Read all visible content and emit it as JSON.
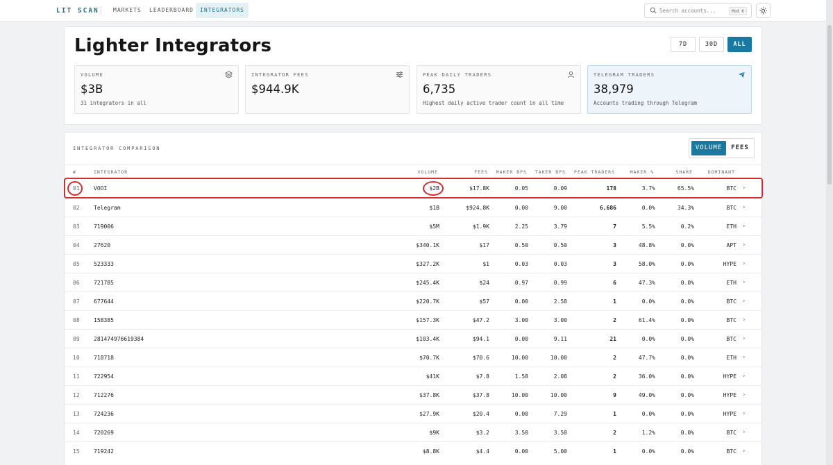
{
  "topbar": {
    "brand": "LIT SCAN",
    "nav": [
      "MARKETS",
      "LEADERBOARD",
      "INTEGRATORS"
    ],
    "active_nav": "INTEGRATORS",
    "search_placeholder": "Search accounts...",
    "search_shortcut": "Mod K"
  },
  "page": {
    "title": "Lighter Integrators",
    "ranges": [
      "7D",
      "30D",
      "ALL"
    ],
    "active_range": "ALL"
  },
  "stats": [
    {
      "label": "VOLUME",
      "value": "$3B",
      "sub": "31 integrators in all",
      "icon": "layers-icon"
    },
    {
      "label": "INTEGRATOR FEES",
      "value": "$944.9K",
      "sub": "",
      "icon": "sliders-icon"
    },
    {
      "label": "PEAK DAILY TRADERS",
      "value": "6,735",
      "sub": "Highest daily active trader count in all time",
      "icon": "user-icon"
    },
    {
      "label": "TELEGRAM TRADERS",
      "value": "38,979",
      "sub": "Accounts trading through Telegram",
      "icon": "send-icon"
    }
  ],
  "comparison": {
    "title": "INTEGRATOR COMPARISON",
    "toggle": [
      "VOLUME",
      "FEES"
    ],
    "active_toggle": "VOLUME",
    "columns": [
      "#",
      "INTEGRATOR",
      "VOLUME",
      "FEES",
      "MAKER BPS",
      "TAKER BPS",
      "PEAK TRADERS",
      "MAKER %",
      "SHARE",
      "DOMINANT"
    ],
    "rows": [
      [
        "01",
        "VOOI",
        "$2B",
        "$17.8K",
        "0.05",
        "0.09",
        "178",
        "3.7%",
        "65.5%",
        "BTC"
      ],
      [
        "02",
        "Telegram",
        "$1B",
        "$924.8K",
        "0.00",
        "9.00",
        "6,686",
        "0.0%",
        "34.3%",
        "BTC"
      ],
      [
        "03",
        "719006",
        "$5M",
        "$1.9K",
        "2.25",
        "3.79",
        "7",
        "5.5%",
        "0.2%",
        "ETH"
      ],
      [
        "04",
        "27620",
        "$340.1K",
        "$17",
        "0.50",
        "0.50",
        "3",
        "48.8%",
        "0.0%",
        "APT"
      ],
      [
        "05",
        "523333",
        "$327.2K",
        "$1",
        "0.03",
        "0.03",
        "3",
        "58.0%",
        "0.0%",
        "HYPE"
      ],
      [
        "06",
        "721785",
        "$245.4K",
        "$24",
        "0.97",
        "0.99",
        "6",
        "47.3%",
        "0.0%",
        "ETH"
      ],
      [
        "07",
        "677644",
        "$220.7K",
        "$57",
        "0.00",
        "2.58",
        "1",
        "0.0%",
        "0.0%",
        "BTC"
      ],
      [
        "08",
        "158385",
        "$157.3K",
        "$47.2",
        "3.00",
        "3.00",
        "2",
        "61.4%",
        "0.0%",
        "BTC"
      ],
      [
        "09",
        "281474976619384",
        "$103.4K",
        "$94.1",
        "0.00",
        "9.11",
        "21",
        "0.0%",
        "0.0%",
        "BTC"
      ],
      [
        "10",
        "718718",
        "$70.7K",
        "$70.6",
        "10.00",
        "10.00",
        "2",
        "47.7%",
        "0.0%",
        "ETH"
      ],
      [
        "11",
        "722954",
        "$41K",
        "$7.8",
        "1.58",
        "2.08",
        "2",
        "36.0%",
        "0.0%",
        "HYPE"
      ],
      [
        "12",
        "712276",
        "$37.8K",
        "$37.8",
        "10.00",
        "10.00",
        "9",
        "49.0%",
        "0.0%",
        "HYPE"
      ],
      [
        "13",
        "724236",
        "$27.9K",
        "$20.4",
        "0.00",
        "7.29",
        "1",
        "0.0%",
        "0.0%",
        "HYPE"
      ],
      [
        "14",
        "720269",
        "$9K",
        "$3.2",
        "3.50",
        "3.50",
        "2",
        "1.2%",
        "0.0%",
        "BTC"
      ],
      [
        "15",
        "719242",
        "$8.8K",
        "$4.4",
        "0.00",
        "5.00",
        "1",
        "0.0%",
        "0.0%",
        "BTC"
      ]
    ]
  },
  "colors": {
    "accent": "#1a79a0",
    "highlight": "#d62c2c"
  }
}
